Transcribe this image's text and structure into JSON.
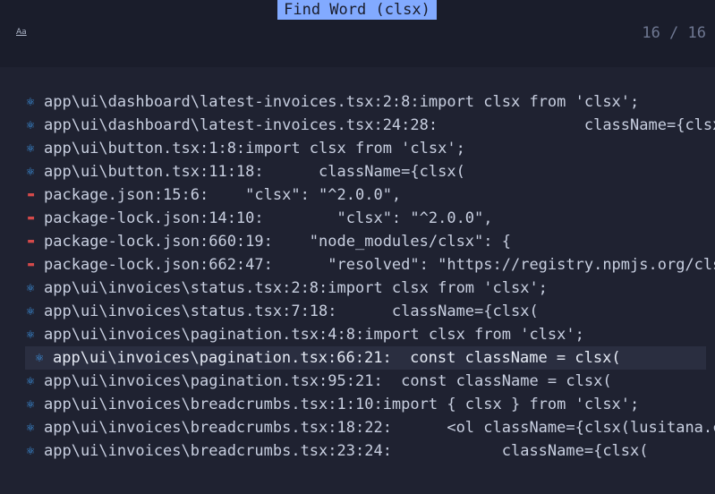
{
  "header": {
    "title": "Find Word (clsx)",
    "case_toggle": "Aa",
    "match_count": "16 / 16"
  },
  "results": [
    {
      "icon": "react-icon",
      "text": "app\\ui\\dashboard\\latest-invoices.tsx:2:8:import clsx from 'clsx';"
    },
    {
      "icon": "react-icon",
      "text": "app\\ui\\dashboard\\latest-invoices.tsx:24:28:                className={clsx"
    },
    {
      "icon": "react-icon",
      "text": "app\\ui\\button.tsx:1:8:import clsx from 'clsx';"
    },
    {
      "icon": "react-icon",
      "text": "app\\ui\\button.tsx:11:18:      className={clsx("
    },
    {
      "icon": "npm-icon",
      "text": "package.json:15:6:    \"clsx\": \"^2.0.0\","
    },
    {
      "icon": "npm-icon",
      "text": "package-lock.json:14:10:        \"clsx\": \"^2.0.0\","
    },
    {
      "icon": "npm-icon",
      "text": "package-lock.json:660:19:    \"node_modules/clsx\": {"
    },
    {
      "icon": "npm-icon",
      "text": "package-lock.json:662:47:      \"resolved\": \"https://registry.npmjs.org/cls"
    },
    {
      "icon": "react-icon",
      "text": "app\\ui\\invoices\\status.tsx:2:8:import clsx from 'clsx';"
    },
    {
      "icon": "react-icon",
      "text": "app\\ui\\invoices\\status.tsx:7:18:      className={clsx("
    },
    {
      "icon": "react-icon",
      "text": "app\\ui\\invoices\\pagination.tsx:4:8:import clsx from 'clsx';"
    },
    {
      "icon": "react-icon",
      "text": "app\\ui\\invoices\\pagination.tsx:66:21:  const className = clsx(",
      "selected": true
    },
    {
      "icon": "react-icon",
      "text": "app\\ui\\invoices\\pagination.tsx:95:21:  const className = clsx("
    },
    {
      "icon": "react-icon",
      "text": "app\\ui\\invoices\\breadcrumbs.tsx:1:10:import { clsx } from 'clsx';"
    },
    {
      "icon": "react-icon",
      "text": "app\\ui\\invoices\\breadcrumbs.tsx:18:22:      <ol className={clsx(lusitana.c"
    },
    {
      "icon": "react-icon",
      "text": "app\\ui\\invoices\\breadcrumbs.tsx:23:24:            className={clsx("
    }
  ]
}
